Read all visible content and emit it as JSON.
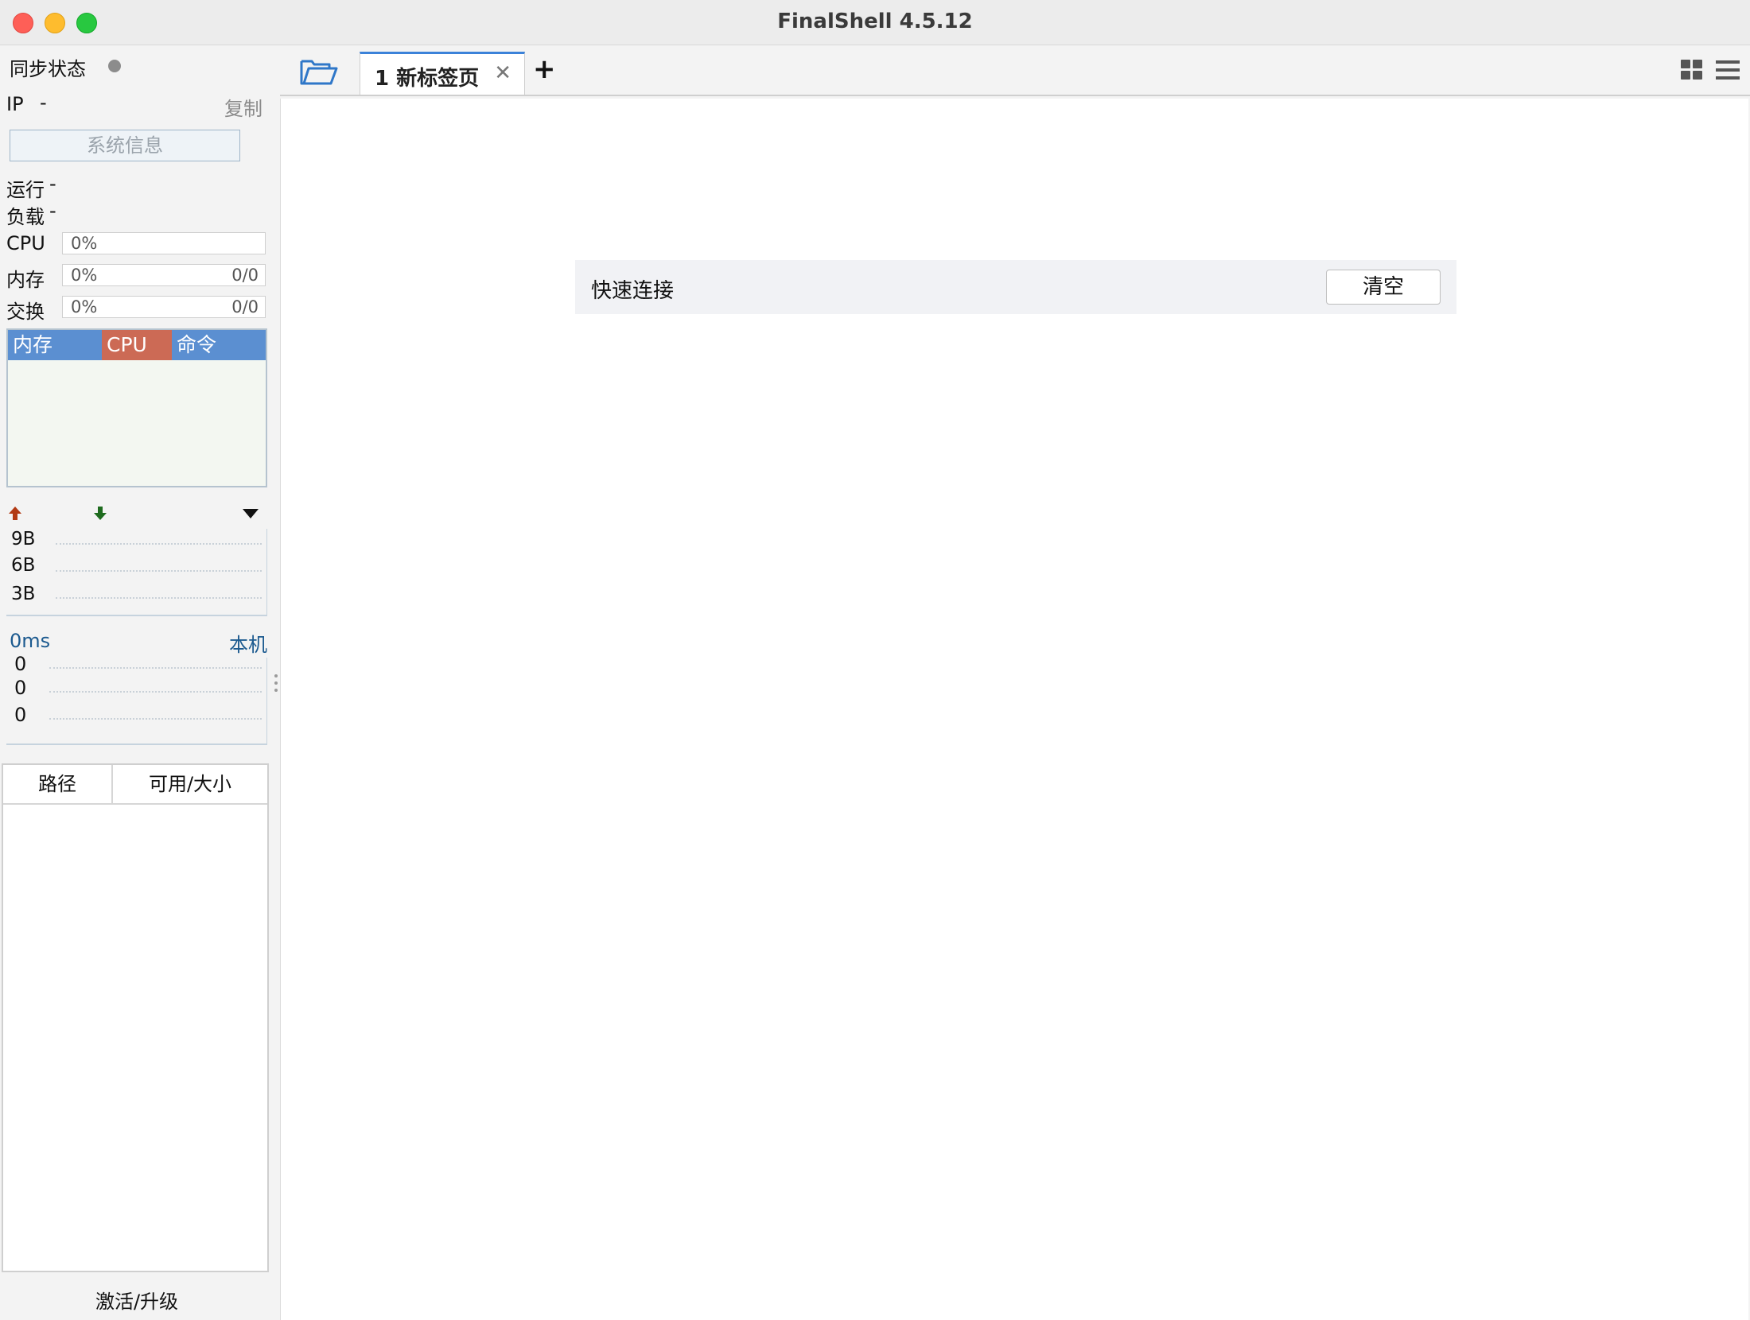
{
  "window": {
    "title": "FinalShell 4.5.12"
  },
  "sidebar": {
    "sync_label": "同步状态",
    "ip_label": "IP",
    "ip_value": "-",
    "copy_label": "复制",
    "sysinfo_label": "系统信息",
    "uptime_label": "运行",
    "uptime_value": "-",
    "load_label": "负载",
    "load_value": "-",
    "cpu": {
      "label": "CPU",
      "percent": "0%"
    },
    "memory": {
      "label": "内存",
      "percent": "0%",
      "value": "0/0"
    },
    "swap": {
      "label": "交换",
      "percent": "0%",
      "value": "0/0"
    },
    "process_tabs": [
      "内存",
      "CPU",
      "命令"
    ],
    "network": {
      "ticks": [
        "9B",
        "6B",
        "3B"
      ]
    },
    "latency": {
      "value": "0ms",
      "host": "本机",
      "ticks": [
        "0",
        "0",
        "0"
      ]
    },
    "disk_headers": [
      "路径",
      "可用/大小"
    ],
    "activate_label": "激活/升级"
  },
  "tabs": {
    "items": [
      {
        "label": "1 新标签页"
      }
    ],
    "add": "+"
  },
  "main": {
    "quick_connect_label": "快速连接",
    "clear_label": "清空"
  }
}
